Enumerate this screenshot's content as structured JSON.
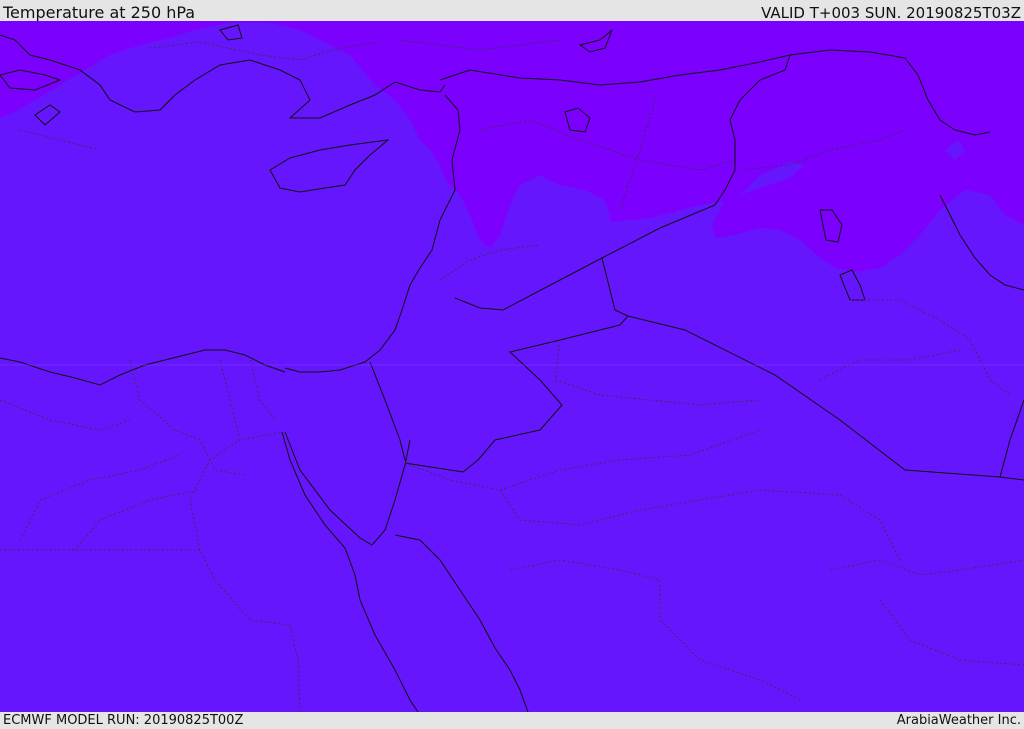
{
  "header": {
    "title": "Temperature at 250 hPa",
    "valid_time": "VALID T+003 SUN. 20190825T03Z"
  },
  "footer": {
    "model_run": "ECMWF MODEL RUN: 20190825T00Z",
    "credit": "ArabiaWeather Inc."
  },
  "colors": {
    "warm_band": "#6616fd",
    "cold_band": "#7c00fe",
    "boundary_line": "#111111",
    "frame": "#e5e5e5"
  }
}
